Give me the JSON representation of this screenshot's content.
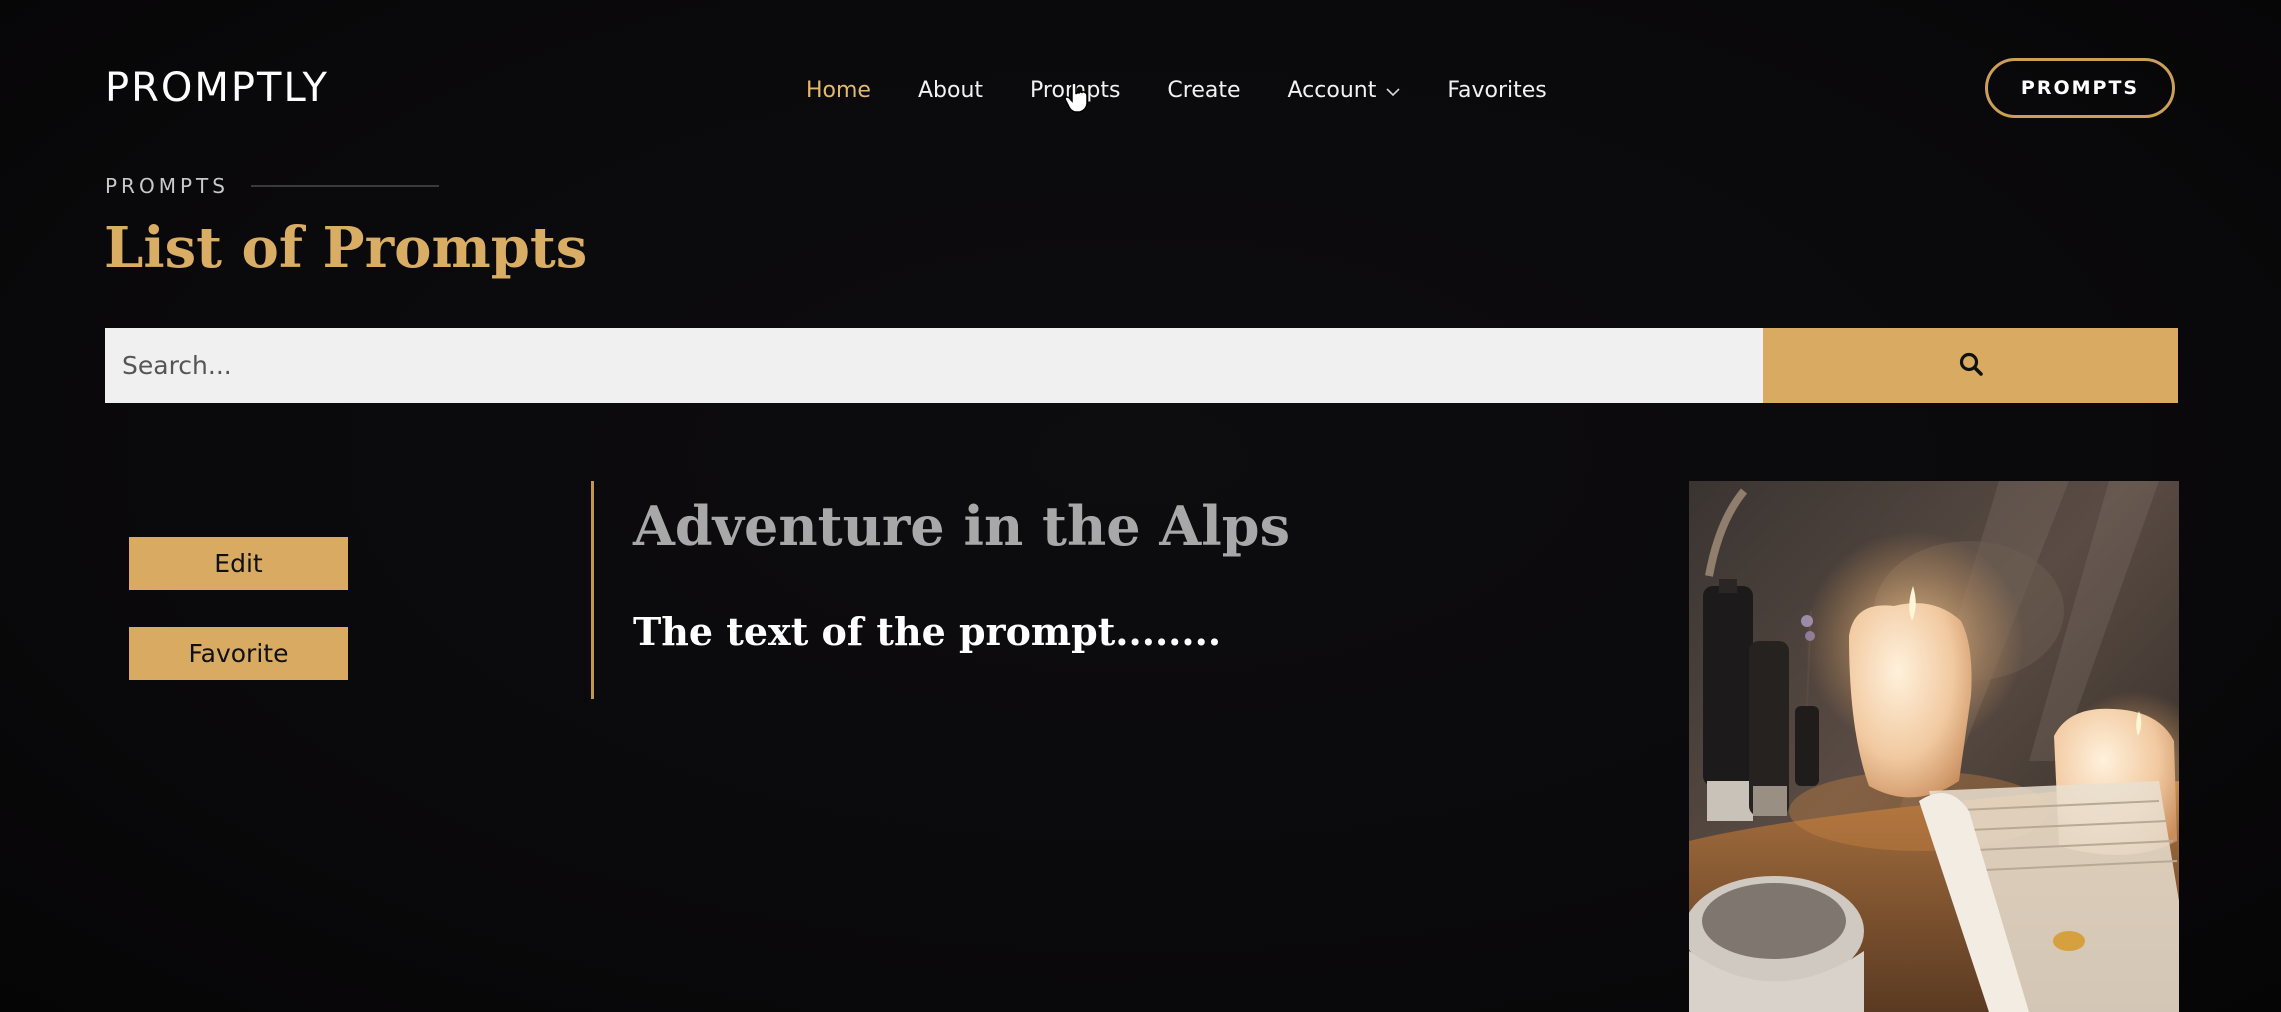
{
  "header": {
    "brand": "PROMPTLY",
    "nav": [
      {
        "label": "Home"
      },
      {
        "label": "About"
      },
      {
        "label": "Prompts"
      },
      {
        "label": "Create"
      },
      {
        "label": "Account"
      },
      {
        "label": "Favorites"
      }
    ],
    "cta_label": "PROMPTS"
  },
  "page": {
    "eyebrow": "PROMPTS",
    "title": "List of Prompts"
  },
  "search": {
    "placeholder": "Search...",
    "button_icon": "search-icon"
  },
  "actions": {
    "edit_label": "Edit",
    "favorite_label": "Favorite"
  },
  "prompt": {
    "title": "Adventure in the Alps",
    "text": "The text of the prompt........",
    "image_icon": "candles-photo"
  },
  "colors": {
    "accent": "#d9ab62",
    "background": "#0b0a0c",
    "active_nav": "#e3b86d"
  }
}
